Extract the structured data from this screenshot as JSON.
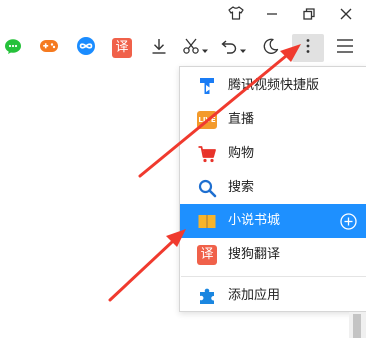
{
  "toolbar": {
    "items": [
      {
        "icon": "wechat-icon",
        "color": "#25c13a"
      },
      {
        "icon": "gamepad-icon",
        "color": "#f57a20"
      },
      {
        "icon": "infinity-icon",
        "color": "#1a8cff"
      },
      {
        "icon": "translate-icon",
        "label": "译",
        "color": "#f0614a"
      },
      {
        "icon": "download-icon"
      },
      {
        "icon": "scissors-icon"
      },
      {
        "icon": "undo-icon"
      },
      {
        "icon": "moon-icon"
      },
      {
        "icon": "more-vertical-icon",
        "active": true
      },
      {
        "icon": "hamburger-menu-icon"
      }
    ]
  },
  "titlebar": {
    "buttons": [
      "shirt-icon",
      "minimize-icon",
      "restore-icon",
      "close-icon"
    ]
  },
  "menu": {
    "items": [
      {
        "label": "腾讯视频快捷版",
        "icon": "tencent-video-icon",
        "color": "#1a7cf5"
      },
      {
        "label": "直播",
        "icon": "live-icon",
        "badge": "LIVE",
        "color": "#f39a2b"
      },
      {
        "label": "购物",
        "icon": "cart-icon",
        "color": "#e8332a"
      },
      {
        "label": "搜索",
        "icon": "search-icon",
        "color": "#1e6fd0"
      },
      {
        "label": "小说书城",
        "icon": "book-icon",
        "color": "#f6b42b",
        "highlighted": true
      },
      {
        "label": "搜狗翻译",
        "icon": "translate-icon",
        "glyph": "译",
        "color": "#f0614a"
      },
      {
        "label": "添加应用",
        "icon": "puzzle-icon",
        "color": "#1a86e0"
      }
    ],
    "accent": "#1e90ff"
  },
  "annotation": {
    "arrow_color": "#f03a2e"
  }
}
